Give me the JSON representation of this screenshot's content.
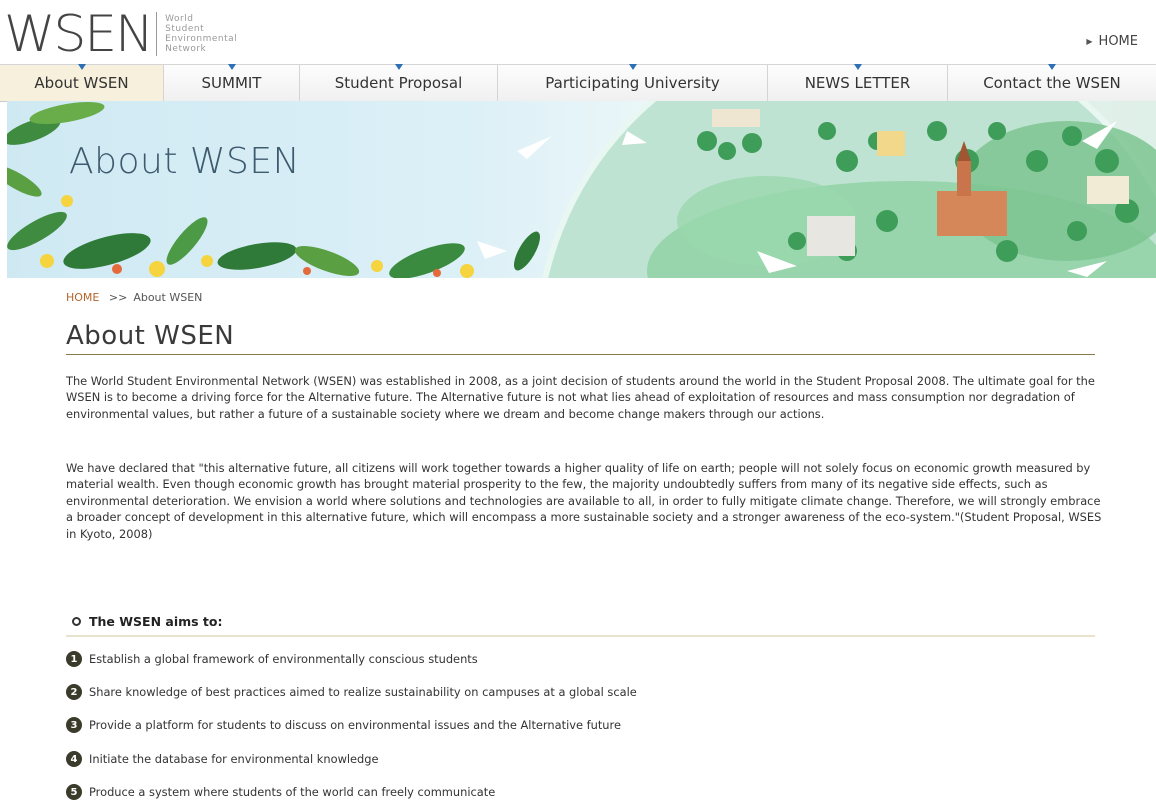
{
  "header": {
    "logo": {
      "word": "WSEN",
      "sub_lines": [
        "World",
        "Student",
        "Environmental",
        "Network"
      ]
    },
    "home_link": "HOME"
  },
  "nav": {
    "items": [
      {
        "label": "About WSEN",
        "active": true
      },
      {
        "label": "SUMMIT",
        "active": false
      },
      {
        "label": "Student Proposal",
        "active": false
      },
      {
        "label": "Participating University",
        "active": false
      },
      {
        "label": "NEWS LETTER",
        "active": false
      },
      {
        "label": "Contact the WSEN",
        "active": false
      }
    ]
  },
  "banner": {
    "title": "About WSEN"
  },
  "breadcrumb": {
    "home": "HOME",
    "separator": ">>",
    "current": "About WSEN"
  },
  "main": {
    "title": "About WSEN",
    "paragraphs": [
      "The World Student Environmental Network (WSEN) was established in 2008, as a joint decision of students around the world in the Student Proposal 2008. The ultimate goal for the WSEN is to become a driving force for the Alternative future. The Alternative future is not what lies ahead of exploitation of resources and mass consumption nor degradation of environmental values, but rather a future of a sustainable society where we dream and become change makers through our actions.",
      "We have declared that \"this alternative future, all citizens will work together towards a higher quality of life on earth; people will not solely focus on economic growth measured by material wealth. Even though economic growth has brought material prosperity to the few, the majority undoubtedly suffers from many of its negative side effects, such as environmental deterioration. We envision a world where solutions and technologies are available to all, in order to fully mitigate climate change. Therefore, we will strongly embrace a broader concept of development in this alternative future, which will encompass a more sustainable society and a stronger awareness of the eco-system.\"(Student Proposal, WSES in Kyoto, 2008)"
    ],
    "aims_heading": "The WSEN aims to:",
    "aims": [
      {
        "num": "1",
        "text": "Establish a global framework of environmentally conscious students"
      },
      {
        "num": "2",
        "text": "Share knowledge of best practices aimed to realize sustainability on campuses at a global scale"
      },
      {
        "num": "3",
        "text": "Provide a platform for students to discuss on environmental issues and the Alternative future"
      },
      {
        "num": "4",
        "text": "Initiate the database for environmental knowledge"
      },
      {
        "num": "5",
        "text": "Produce a system where students of the world can freely communicate"
      }
    ]
  },
  "colors": {
    "accent_brown": "#b5652b",
    "nav_pin_blue": "#2d6fb5",
    "title_rule": "#8b7a4a"
  }
}
